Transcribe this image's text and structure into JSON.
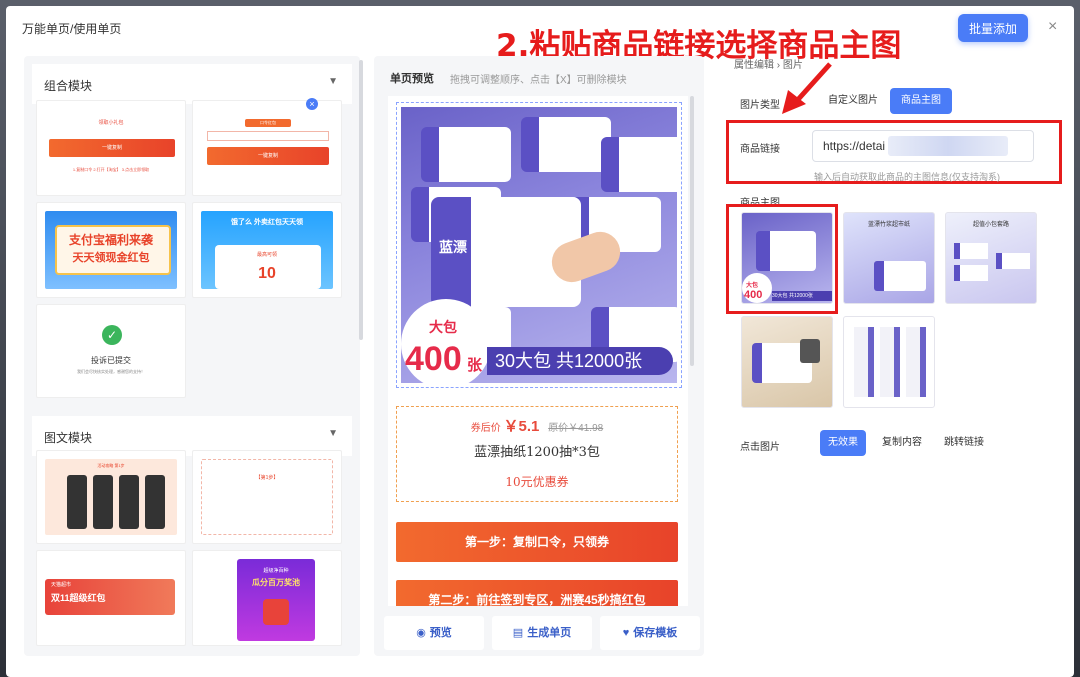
{
  "modal": {
    "title": "万能单页/使用单页",
    "batch_add": "批量添加",
    "close": "×"
  },
  "annotation": {
    "title": "2.粘贴商品链接选择商品主图"
  },
  "left": {
    "section1": "组合模块",
    "section2": "图文模块",
    "tiles": {
      "t1a": "领取小礼包",
      "t1b": "一键复制",
      "t1c": "1.复制口令  2.打开【淘宝】  3.点击立即领取",
      "t2a": "口令红包",
      "t2b": "一键复制",
      "t3a": "支付宝福利来袭",
      "t3b": "天天领现金红包",
      "t4a": "饿了么  外卖红包天天领",
      "t4b": "最高可领",
      "t4c": "10",
      "t5a": "投诉已提交",
      "t5b": "我们会尽快核实处理，感谢您的支持！",
      "t6a": "活动攻略 第1步",
      "t7a": "【第1步】",
      "t8a": "天猫超市",
      "t8b": "双11超级红包",
      "t9a": "超级净百种",
      "t9b": "瓜分百万奖池"
    }
  },
  "middle": {
    "heading": "单页预览",
    "hint": "拖拽可调整顺序、点击【X】可删除模块",
    "badge_small": "大包",
    "badge_big": "400",
    "badge_unit": "张",
    "badge_bar": "30大包 共12000张",
    "pack_brand": "蓝漂",
    "coupon_price_label": "券后价",
    "coupon_price": "￥5.1",
    "coupon_orig": "原价￥41.98",
    "coupon_name": "蓝漂抽纸1200抽*3包",
    "coupon_amount": "10元优惠券",
    "step1": "第一步：复制口令，只领券",
    "step2": "第二步：前往签到专区，洲赛45秒搞红包",
    "actions": {
      "preview": "预览",
      "generate": "生成单页",
      "save_template": "保存模板"
    }
  },
  "right": {
    "breadcrumb": "属性编辑  ›  图片",
    "image_type_label": "图片类型",
    "image_type_options": [
      "自定义图片",
      "商品主图"
    ],
    "image_type_selected": "商品主图",
    "link_label": "商品链接",
    "link_value": "https://detai",
    "link_hint": "输入后自动获取此商品的主图信息(仅支持淘系)",
    "main_image_label": "商品主图",
    "thumb_texts": {
      "th1a": "大包",
      "th1b": "400",
      "th1c": "30大包 共12000张",
      "th2": "蓝漂竹浆超市纸",
      "th3": "超值小包套路"
    },
    "click_label": "点击图片",
    "click_options": [
      "无效果",
      "复制内容",
      "跳转链接"
    ],
    "click_selected": "无效果"
  },
  "colors": {
    "accent": "#4a7cf7",
    "annotation_red": "#e61c1c",
    "product_purple": "#6a62c8",
    "step_orange": "#f26a2e"
  },
  "icons": {
    "close": "close-icon",
    "caret": "caret-down-icon",
    "eye": "eye-icon",
    "doc": "document-icon",
    "heart": "heart-icon",
    "check": "check-circle-icon",
    "arrow": "annotation-arrow-icon"
  }
}
